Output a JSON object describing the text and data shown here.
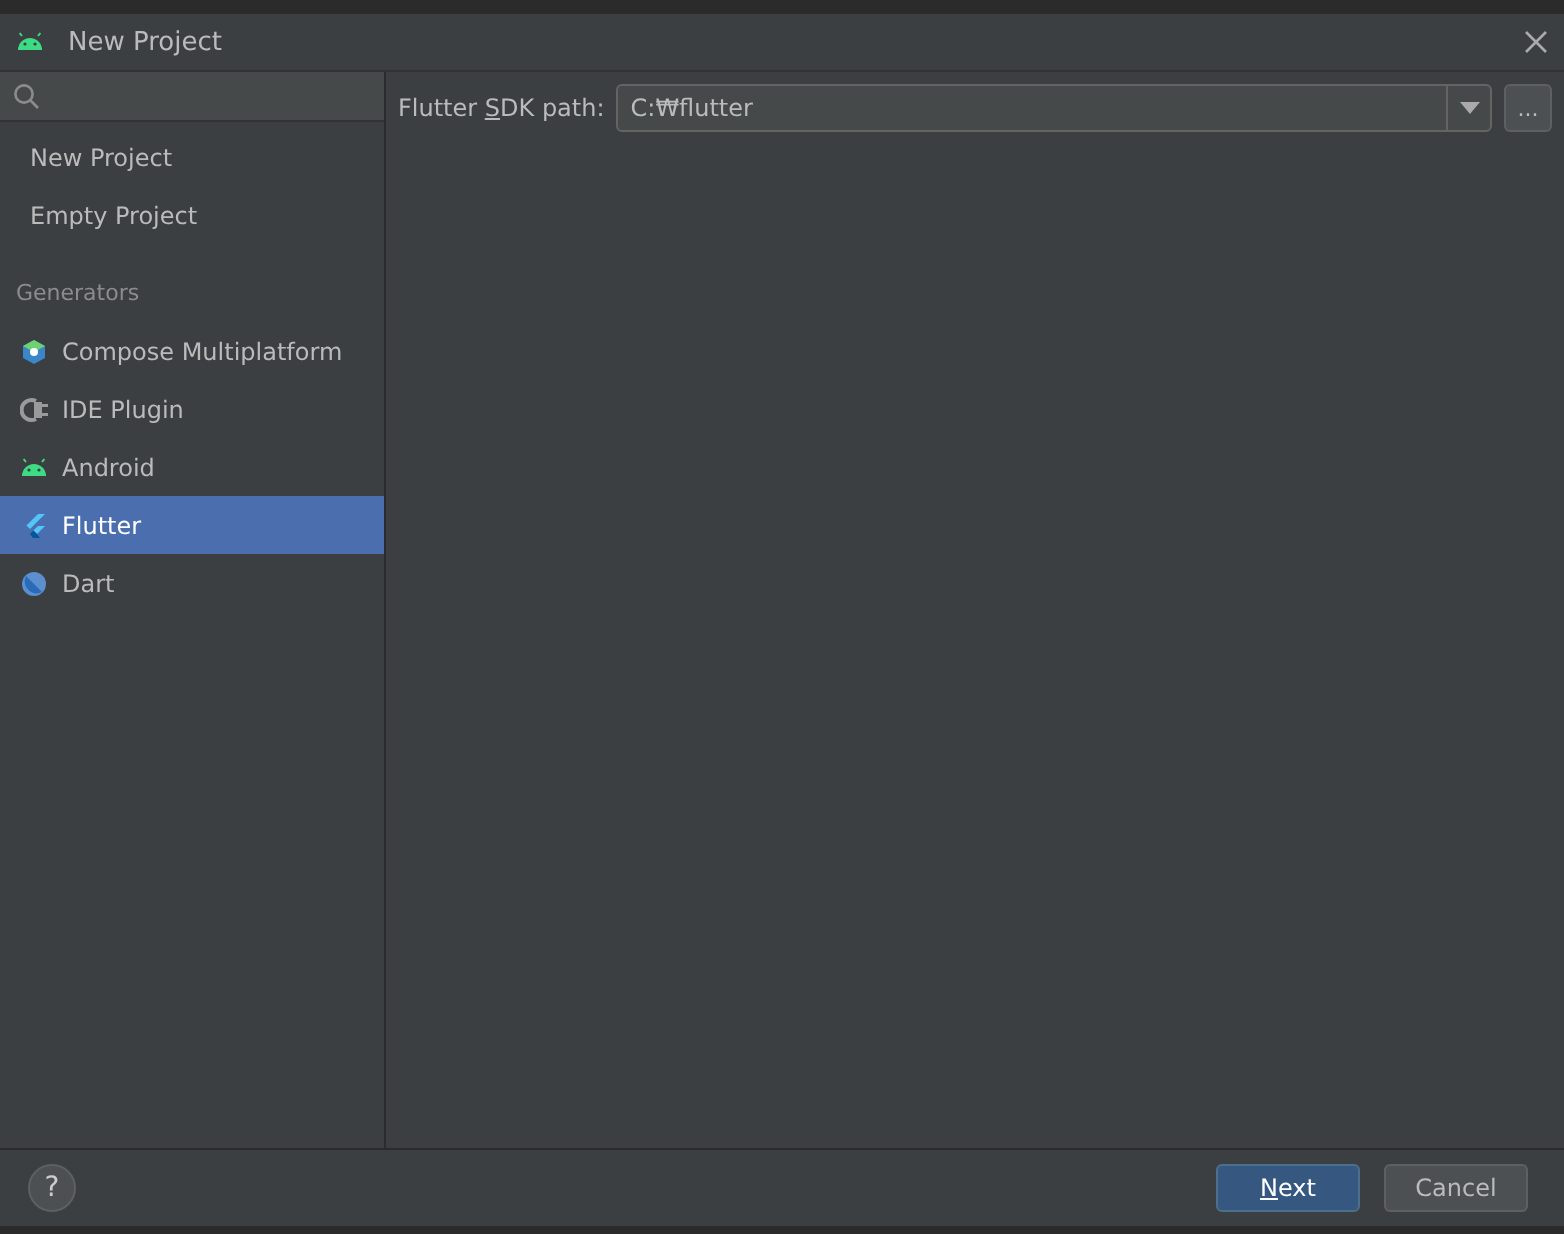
{
  "window": {
    "title": "New Project"
  },
  "sidebar": {
    "items": [
      {
        "label": "New Project",
        "selected": false
      },
      {
        "label": "Empty Project",
        "selected": false
      }
    ],
    "generators_heading": "Generators",
    "generators": [
      {
        "label": "Compose Multiplatform",
        "kind": "compose",
        "selected": false
      },
      {
        "label": "IDE Plugin",
        "kind": "plugin",
        "selected": false
      },
      {
        "label": "Android",
        "kind": "android",
        "selected": false
      },
      {
        "label": "Flutter",
        "kind": "flutter",
        "selected": true
      },
      {
        "label": "Dart",
        "kind": "dart",
        "selected": false
      }
    ]
  },
  "sdk_path": {
    "label_parts": [
      "Flutter ",
      "S",
      "DK path:"
    ],
    "value": "C:₩flutter",
    "browse": "..."
  },
  "footer": {
    "help": "?",
    "next_parts": [
      "N",
      "ext"
    ],
    "cancel": "Cancel"
  }
}
